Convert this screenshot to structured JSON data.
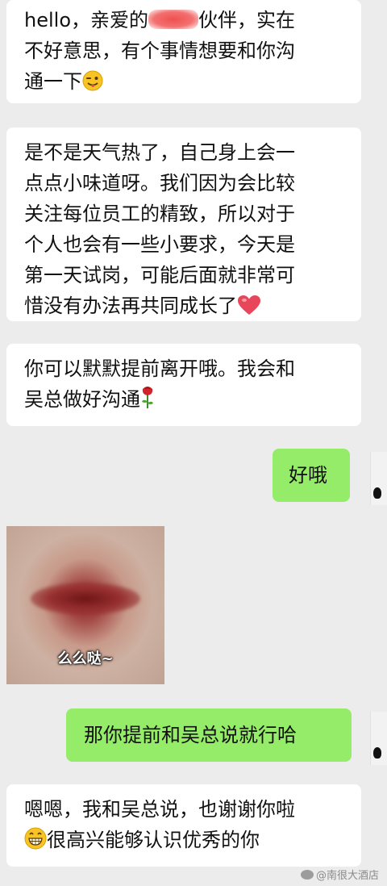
{
  "messages": [
    {
      "side": "left",
      "parts": [
        "hello，亲爱的",
        "伙伴，实在\n不好意思，有个事情想要和你沟\n通一下"
      ],
      "emoji": "winking-tongue-face"
    },
    {
      "side": "left",
      "text": "是不是天气热了，自己身上会一\n点点小味道呀。我们因为会比较\n关注每位员工的精致，所以对于\n个人也会有一些小要求，今天是\n第一天试岗，可能后面就非常可\n惜没有办法再共同成长了",
      "emoji": "heart"
    },
    {
      "side": "left",
      "text": "你可以默默提前离开哦。我会和\n吴总做好沟通",
      "emoji": "rose"
    },
    {
      "side": "right",
      "text": "好哦"
    },
    {
      "side": "left",
      "type": "image",
      "caption": "么么哒~"
    },
    {
      "side": "right",
      "text": "那你提前和吴总说就行哈"
    },
    {
      "side": "left",
      "line1": "嗯嗯，我和吴总说，也谢谢你啦",
      "line2": "很高兴能够认识优秀的你",
      "emoji": "grinning-face"
    }
  ],
  "watermark": "@南很大酒店",
  "colors": {
    "background": "#ececec",
    "incoming": "#ffffff",
    "outgoing": "#95ec69",
    "redaction": "#f05050"
  }
}
